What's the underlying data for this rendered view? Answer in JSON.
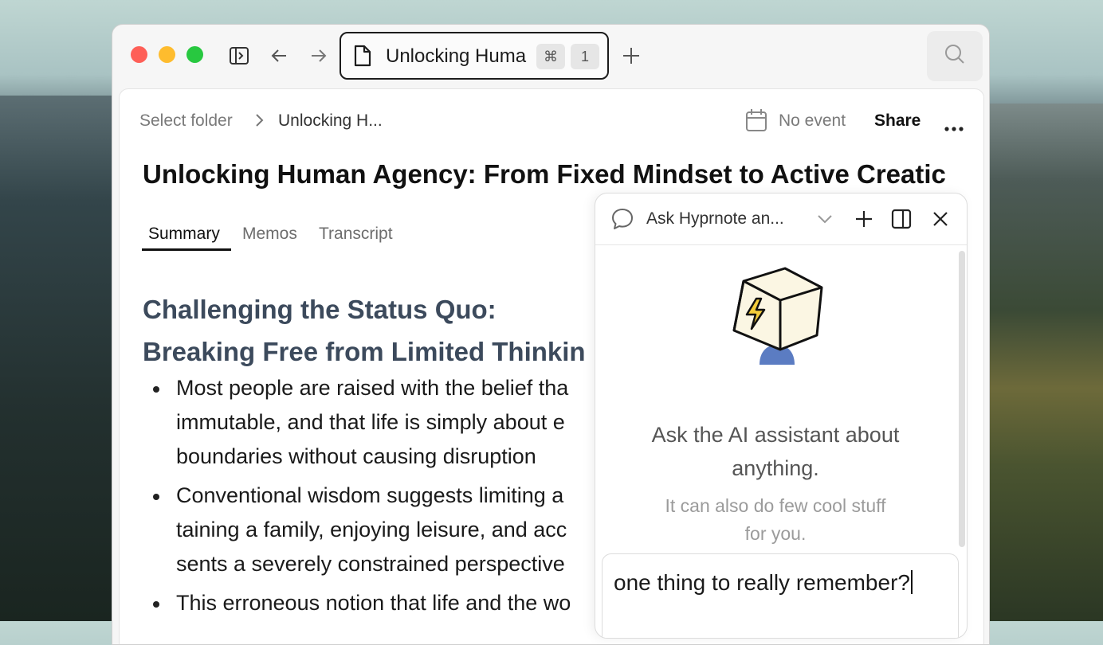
{
  "window": {
    "tab_title": "Unlocking Huma",
    "tab_shortcut_symbol": "⌘",
    "tab_shortcut_key": "1"
  },
  "header": {
    "breadcrumb_folder": "Select folder",
    "breadcrumb_current": "Unlocking H...",
    "event_label": "No event",
    "share_label": "Share"
  },
  "doc": {
    "title": "Unlocking Human Agency: From Fixed Mindset to Active Creatic",
    "tabs": [
      "Summary",
      "Memos",
      "Transcript"
    ],
    "active_tab": "Summary",
    "section_heading_line1": "Challenging the Status Quo:",
    "section_heading_line2": "Breaking Free from Limited Thinkin",
    "bullets": [
      [
        "Most people are raised with the belief tha",
        "immutable, and that life is simply about e",
        "boundaries without causing disruption"
      ],
      [
        "Conventional wisdom suggests limiting a",
        "taining a family, enjoying leisure, and acc",
        "sents a severely constrained perspective"
      ],
      [
        "This erroneous notion that life and the wo"
      ]
    ]
  },
  "assistant": {
    "title": "Ask Hyprnote an...",
    "prompt_heading_1": "Ask the AI assistant about",
    "prompt_heading_2": "anything.",
    "prompt_sub_1": "It can also do few cool stuff",
    "prompt_sub_2": "for you.",
    "input_value": "one thing to really remember?",
    "mascot_accent": "#f3cc3a"
  },
  "icons": [
    "sidebar-toggle-icon",
    "back-arrow-icon",
    "forward-arrow-icon",
    "document-icon",
    "plus-icon",
    "search-icon",
    "chevron-right-icon",
    "calendar-icon",
    "more-icon",
    "chat-bubble-icon",
    "chevron-down-icon",
    "split-view-icon",
    "close-icon",
    "mascot-icon"
  ]
}
